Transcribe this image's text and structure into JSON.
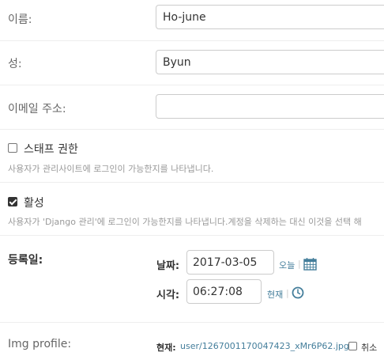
{
  "fields": {
    "first_name": {
      "label": "이름:",
      "value": "Ho-june"
    },
    "last_name": {
      "label": "성:",
      "value": "Byun"
    },
    "email": {
      "label": "이메일 주소:",
      "value": ""
    },
    "is_staff": {
      "label": "스태프 권한",
      "checked": false,
      "help": "사용자가 관리사이트에 로그인이 가능한지를 나타냅니다."
    },
    "is_active": {
      "label": "활성",
      "checked": true,
      "help": "사용자가 'Django 관리'에 로그인이 가능한지를 나타냅니다.계정을 삭제하는 대신 이것을 선택 해"
    },
    "date_joined": {
      "label": "등록일:",
      "date_label": "날짜:",
      "date_value": "2017-03-05",
      "today_link": "오늘",
      "time_label": "시각:",
      "time_value": "06:27:08",
      "now_link": "현재",
      "separator": "|",
      "calendar_icon": "calendar-icon",
      "clock_icon": "clock-icon"
    },
    "img_profile": {
      "label": "Img profile:",
      "current_label": "현재:",
      "file_name": "user/1267001170047423_xMr6P62.jpg",
      "clear_label": "취소"
    }
  },
  "colors": {
    "link": "#447e9b",
    "border": "#cccccc",
    "divider": "#eeeeee",
    "help_text": "#999999"
  }
}
